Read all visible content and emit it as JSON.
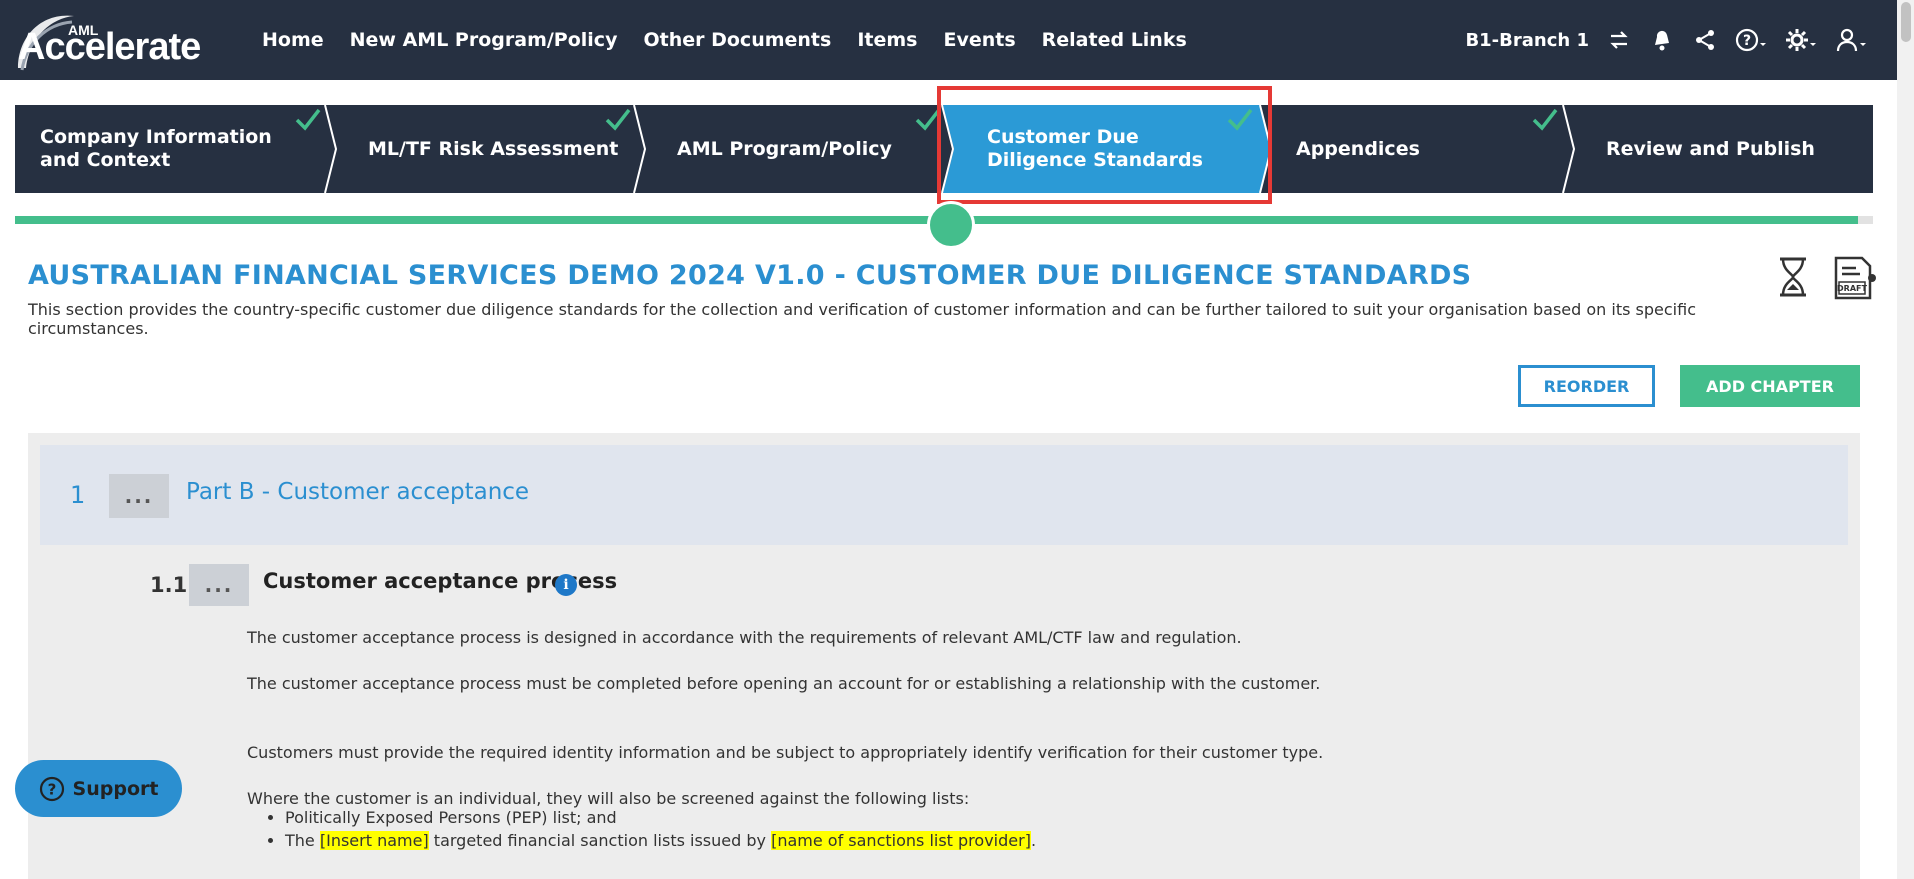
{
  "brand": {
    "aml": "AML",
    "name": "Accelerate"
  },
  "nav": {
    "items": [
      "Home",
      "New AML Program/Policy",
      "Other Documents",
      "Items",
      "Events",
      "Related Links"
    ],
    "branch": "B1-Branch 1"
  },
  "stepper": {
    "steps": [
      {
        "label": "Company Information\nand Context",
        "completed": true
      },
      {
        "label": "ML/TF Risk Assessment",
        "completed": true
      },
      {
        "label": "AML Program/Policy",
        "completed": true
      },
      {
        "label": "Customer Due\nDiligence Standards",
        "completed": true,
        "active": true
      },
      {
        "label": "Appendices",
        "completed": true
      },
      {
        "label": "Review and Publish",
        "completed": false
      }
    ],
    "active_color": "#2b9ad6",
    "complete_color": "#44be8c"
  },
  "page": {
    "title": "AUSTRALIAN FINANCIAL SERVICES DEMO 2024 V1.0 - CUSTOMER DUE DILIGENCE STANDARDS",
    "description": "This section provides the country-specific customer due diligence standards for the collection and verification of customer information and can be further tailored to suit your organisation based on its specific circumstances."
  },
  "actions": {
    "reorder": "REORDER",
    "add_chapter": "ADD CHAPTER"
  },
  "chapter": {
    "number": "1",
    "dots": "...",
    "title": "Part B - Customer acceptance",
    "section": {
      "number": "1.1",
      "dots": "...",
      "title": "Customer acceptance process",
      "info": "i",
      "paragraphs": [
        "The customer acceptance process is designed in accordance with the requirements of relevant AML/CTF law and regulation.",
        "The customer acceptance process must be completed before opening an account for or establishing a relationship with the customer.",
        "Customers must provide the required identity information and be subject to appropriately identify verification for their customer type.",
        "Where the customer is an individual, they will also be screened against the following lists:"
      ],
      "bullets": {
        "pep": "Politically Exposed Persons (PEP) list; and",
        "sanction_prefix": "The",
        "sanction_placeholder_1": "[Insert name]",
        "sanction_middle": "targeted financial sanction lists issued by",
        "sanction_placeholder_2": "[name of sanctions list provider]",
        "sanction_suffix": "."
      }
    }
  },
  "support": {
    "label": "Support"
  }
}
